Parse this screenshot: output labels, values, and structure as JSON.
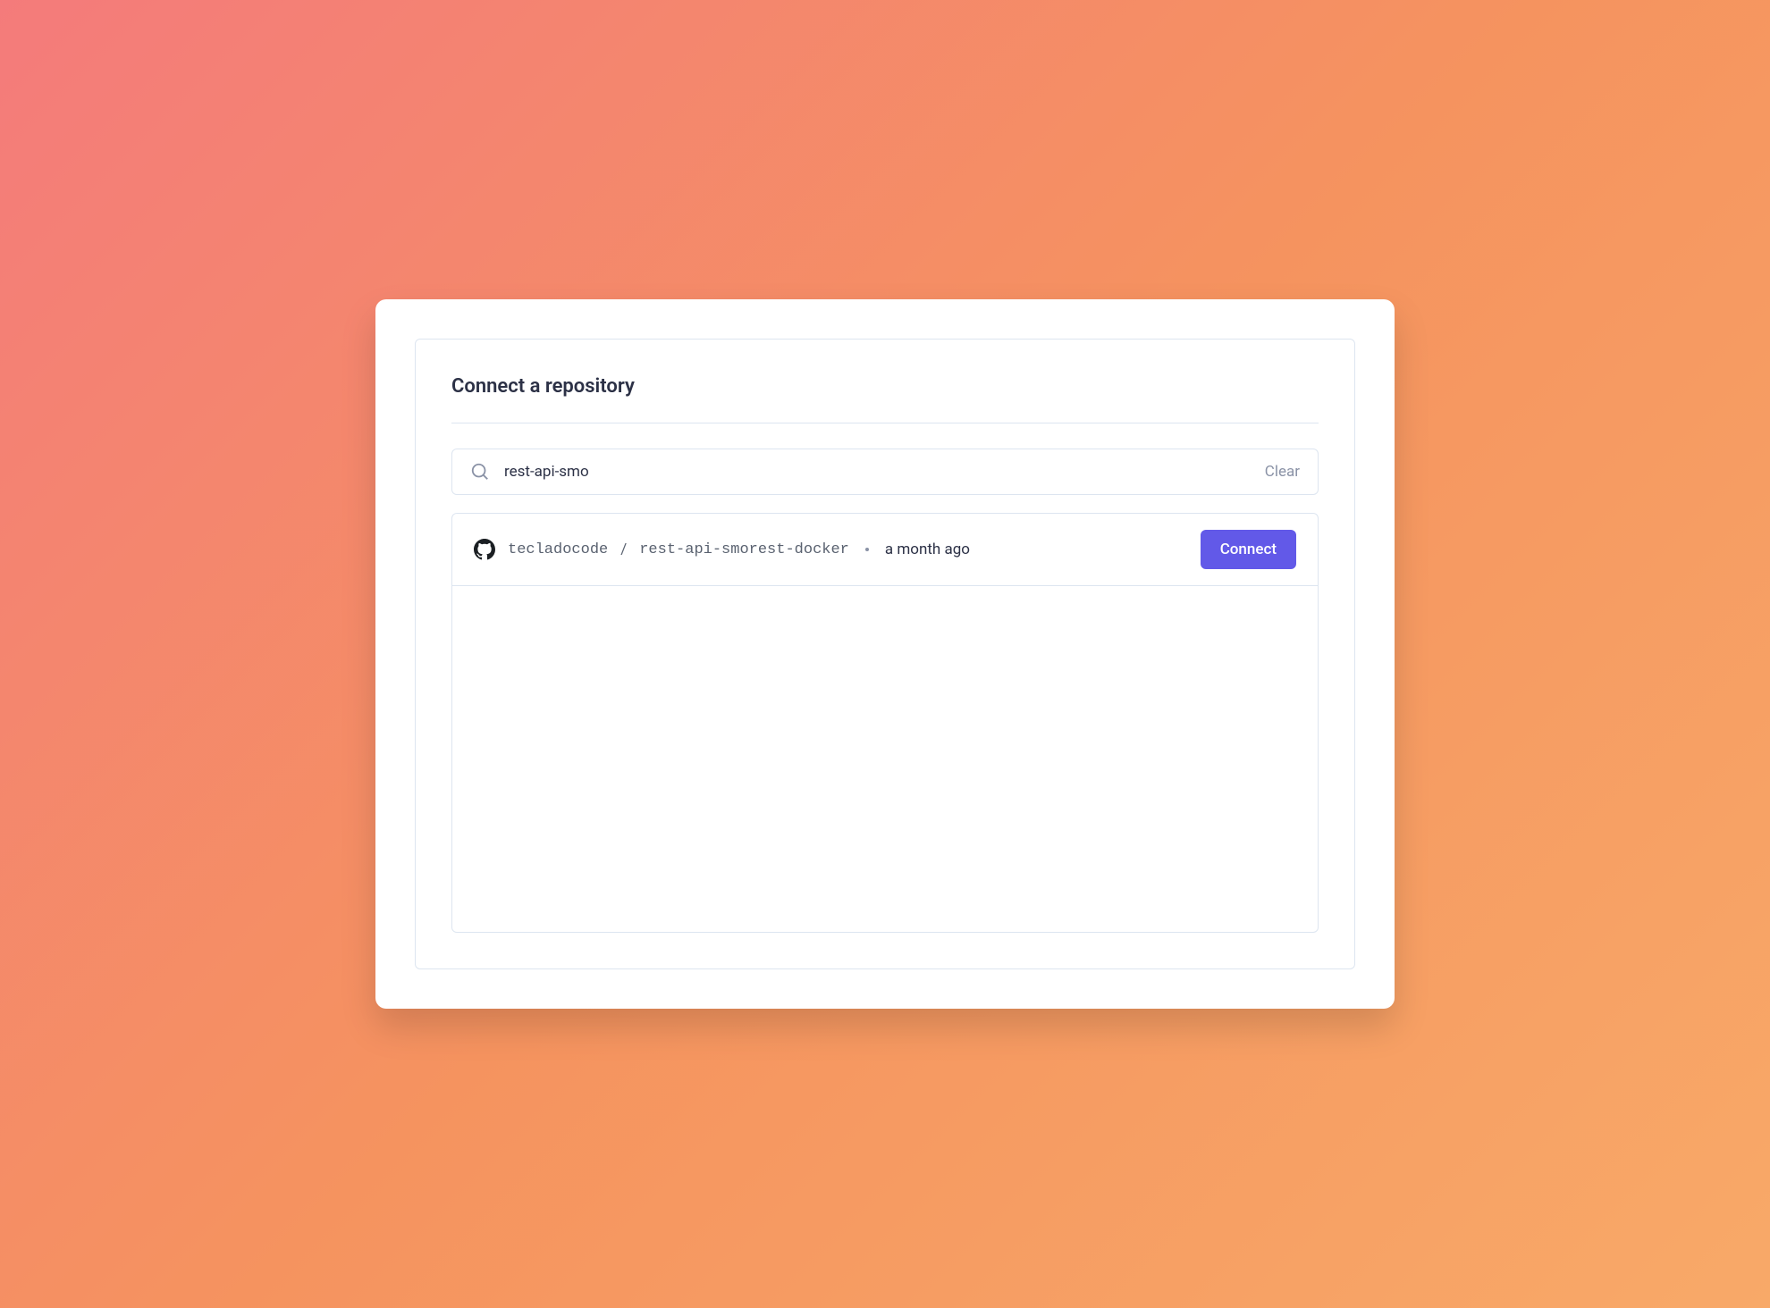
{
  "panel": {
    "title": "Connect a repository"
  },
  "search": {
    "value": "rest-api-smo",
    "clear_label": "Clear"
  },
  "results": [
    {
      "owner": "tecladocode",
      "name": "rest-api-smorest-docker",
      "time": "a month ago",
      "connect_label": "Connect"
    }
  ]
}
